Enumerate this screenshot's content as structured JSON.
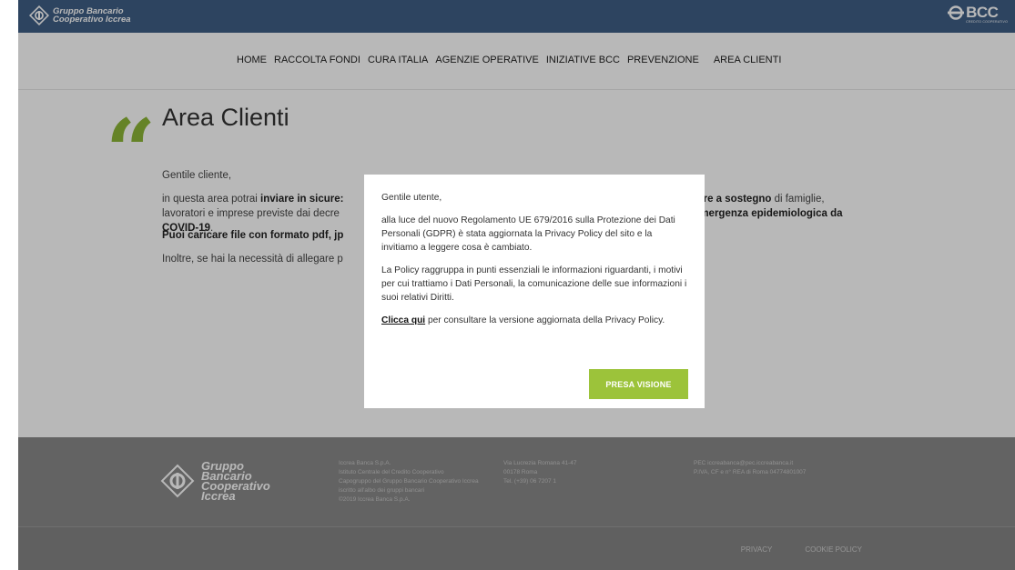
{
  "header": {
    "brand_line1": "Gruppo Bancario",
    "brand_line2": "Cooperativo Iccrea",
    "right_logo": "BCC",
    "right_logo_sub": "CREDITO COOPERATIVO"
  },
  "nav": {
    "items": [
      {
        "label": "HOME"
      },
      {
        "label": "RACCOLTA FONDI"
      },
      {
        "label": "CURA ITALIA"
      },
      {
        "label": "AGENZIE OPERATIVE"
      },
      {
        "label": "INIZIATIVE BCC"
      },
      {
        "label": "PREVENZIONE"
      },
      {
        "label": "AREA CLIENTI"
      }
    ]
  },
  "main": {
    "title": "Area Clienti",
    "greeting": "Gentile cliente,",
    "p2_left_a": "in questa area potrai ",
    "p2_left_b": "inviare in sicure:",
    "p2_left_c": "lavoratori e imprese previste dai decre",
    "p2_left_d": "COVID-19",
    "p2_right_a": "isure a sostegno",
    "p2_right_b": " di famiglie,",
    "p2_right_c": "l'emergenza epidemiologica da",
    "p3": "Puoi caricare file con formato pdf, jp",
    "p4": "Inoltre, se hai la necessità di allegare p"
  },
  "footer": {
    "logo_lines": [
      "Gruppo",
      "Bancario",
      "Cooperativo",
      "Iccrea"
    ],
    "col1": [
      "Iccrea Banca S.p.A.",
      "Istituto Centrale del Credito Cooperativo",
      "Capogruppo del Gruppo Bancario Cooperativo Iccrea",
      "iscritto all'albo dei gruppi bancari",
      "©2019 Iccrea Banca S.p.A."
    ],
    "col2": [
      "Via Lucrezia Romana 41-47",
      "00178 Roma",
      "Tel. (+39) 06 7207 1"
    ],
    "col3": [
      "PEC iccreabanca@pec.iccreabanca.it",
      "P.IVA, CF e n° REA di Roma 04774801007"
    ],
    "links": [
      "PRIVACY",
      "COOKIE POLICY"
    ]
  },
  "modal": {
    "greeting": "Gentile utente,",
    "p1": "alla luce del nuovo Regolamento UE 679/2016 sulla Protezione dei Dati Personali (GDPR) è stata aggiornata la Privacy Policy del sito e la invitiamo a leggere cosa è cambiato.",
    "p2": "La Policy raggruppa in punti essenziali le informazioni riguardanti, i motivi per cui trattiamo i Dati Personali, la comunicazione delle sue informazioni i suoi relativi Diritti.",
    "link_label": "Clicca qui",
    "p3_rest": " per consultare la versione aggiornata della Privacy Policy.",
    "button_label": "PRESA VISIONE"
  },
  "colors": {
    "topbar": "#3f5f86",
    "accent_green": "#9cc33a",
    "quote_green": "#8db636",
    "footer": "#8a8a8a"
  }
}
